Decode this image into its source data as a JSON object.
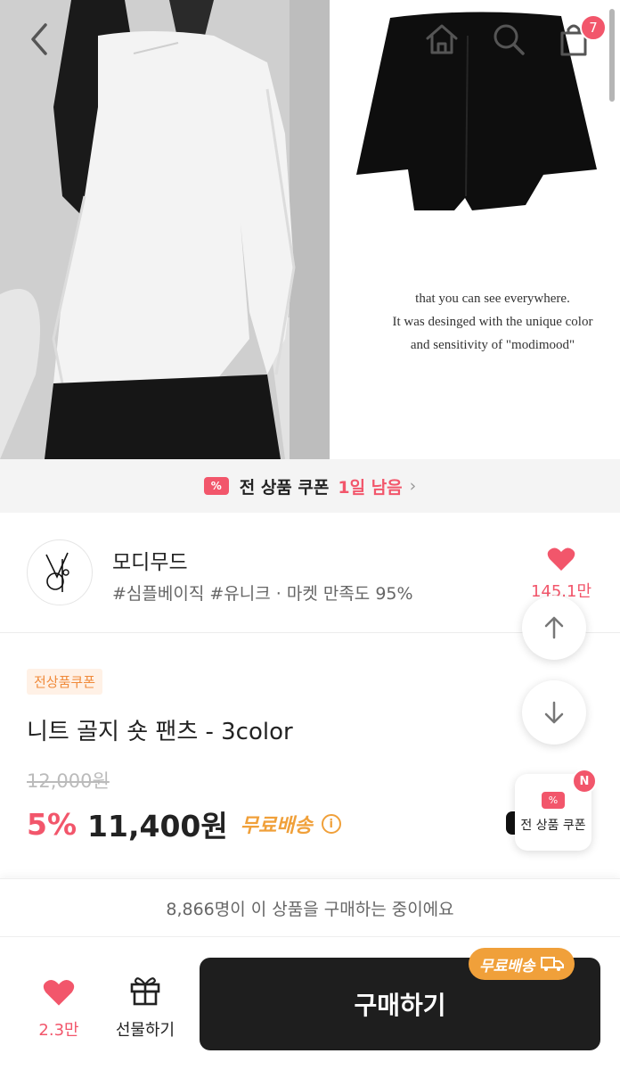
{
  "header": {
    "cart_count": "7"
  },
  "product_image": {
    "caption_lines": [
      "that you can see everywhere.",
      "It was desinged with the unique color",
      "and sensitivity of \"modimood\""
    ]
  },
  "coupon_banner": {
    "label": "전 상품 쿠폰",
    "remaining": "1일 남음"
  },
  "shop": {
    "name": "모디무드",
    "tags": "#심플베이직 #유니크 · 마켓 만족도 95%",
    "like_count": "145.1만"
  },
  "product": {
    "badge": "전상품쿠폰",
    "title": "니트 골지 숏 팬츠 - 3color",
    "original_price": "12,000원",
    "discount": "5%",
    "price": "11,400원",
    "shipping": "무료배송"
  },
  "floating": {
    "coupon_label": "전 상품 쿠폰",
    "new_badge": "N"
  },
  "buyers_text": "8,866명이 이 상품을 구매하는 중이에요",
  "bottom_bar": {
    "like_count": "2.3만",
    "gift_label": "선물하기",
    "buy_label": "구매하기",
    "shipping_pill": "무료배송"
  },
  "colors": {
    "accent_red": "#f2566b",
    "shipping_orange": "#f0a03a",
    "buy_button": "#1e1e1e"
  }
}
